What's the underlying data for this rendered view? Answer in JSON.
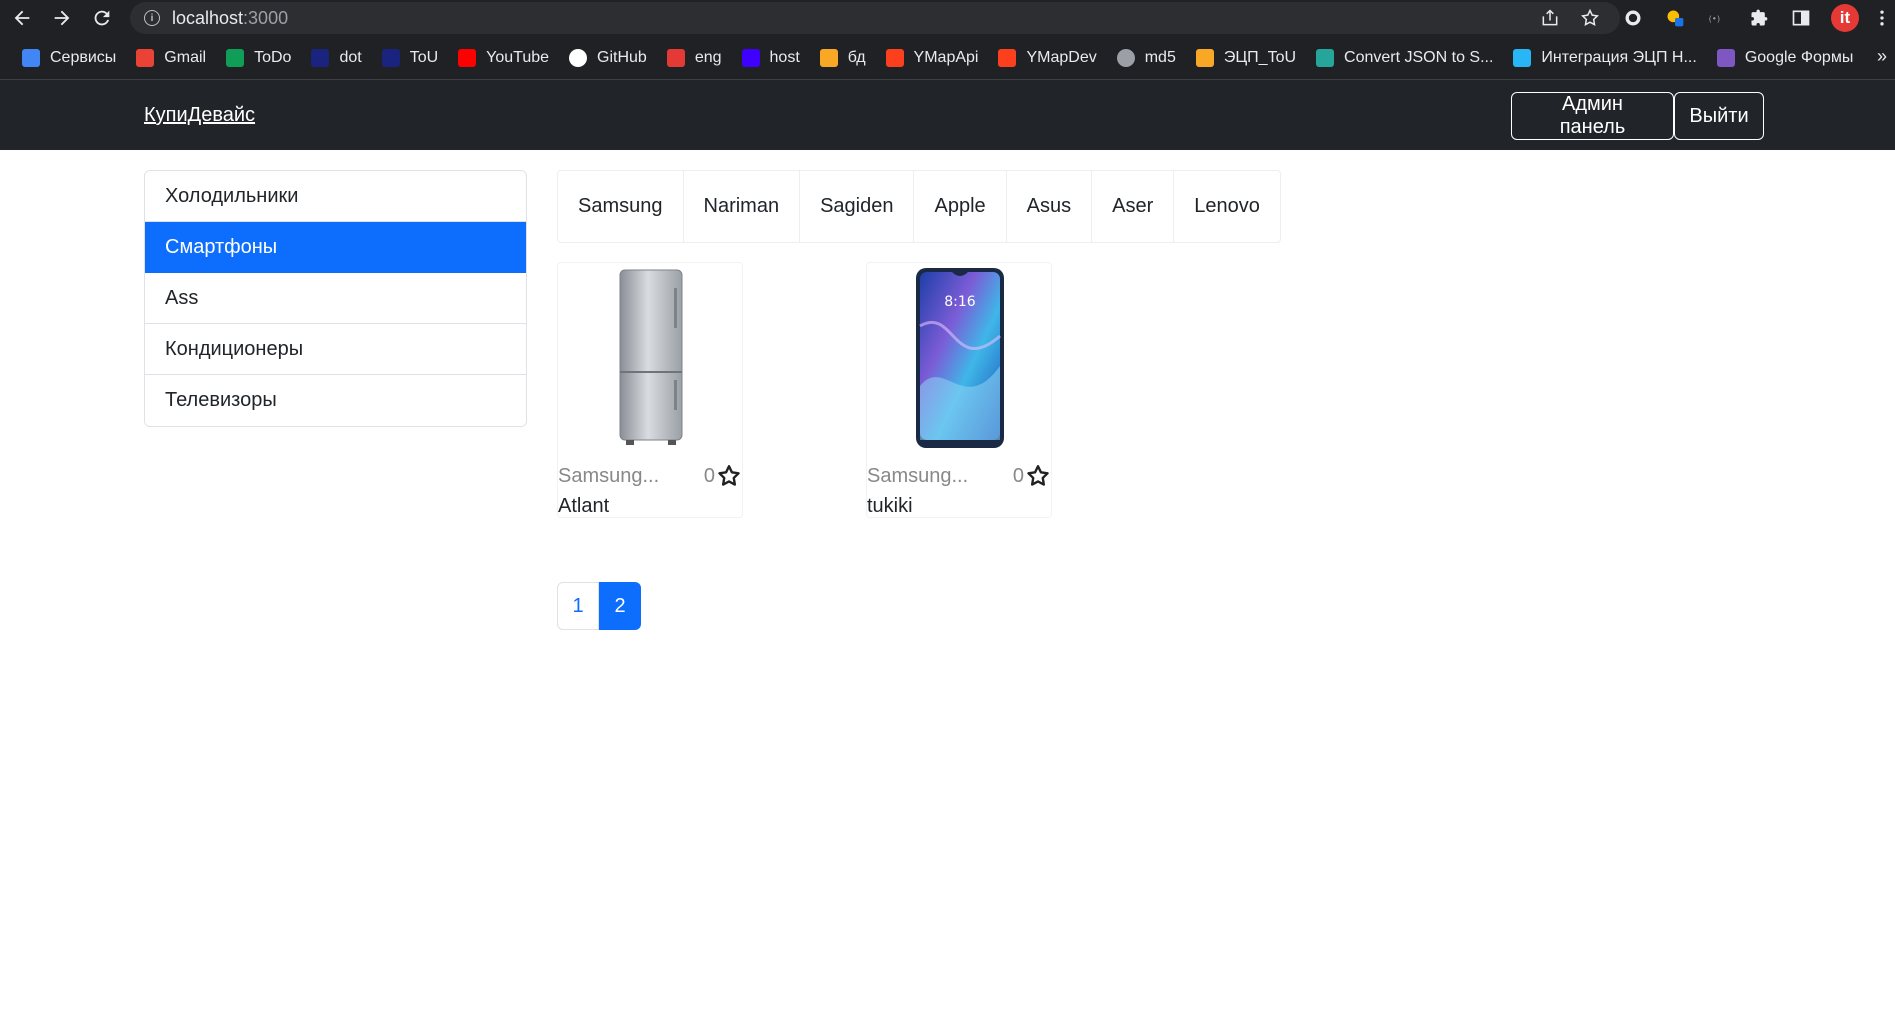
{
  "browser": {
    "url_host": "localhost",
    "url_port": ":3000",
    "bookmarks": [
      {
        "label": "Сервисы",
        "icon": "apps-grid-icon",
        "color": "#4285f4"
      },
      {
        "label": "Gmail",
        "icon": "gmail-icon",
        "color": "#ea4335"
      },
      {
        "label": "ToDo",
        "icon": "todo-icon",
        "color": "#0f9d58"
      },
      {
        "label": "dot",
        "icon": "dot-icon",
        "color": "#1a237e"
      },
      {
        "label": "ToU",
        "icon": "tou-icon",
        "color": "#1a237e"
      },
      {
        "label": "YouTube",
        "icon": "youtube-icon",
        "color": "#ff0000"
      },
      {
        "label": "GitHub",
        "icon": "github-icon",
        "color": "#ffffff"
      },
      {
        "label": "eng",
        "icon": "eng-icon",
        "color": "#e53935"
      },
      {
        "label": "host",
        "icon": "host-icon",
        "color": "#3f00ff"
      },
      {
        "label": "бд",
        "icon": "db-icon",
        "color": "#f9a825"
      },
      {
        "label": "YMapApi",
        "icon": "yandex-icon",
        "color": "#fc3f1d"
      },
      {
        "label": "YMapDev",
        "icon": "yandex-icon",
        "color": "#fc3f1d"
      },
      {
        "label": "md5",
        "icon": "globe-icon",
        "color": "#9aa0a6"
      },
      {
        "label": "ЭЦП_ToU",
        "icon": "rocket-icon",
        "color": "#f9a825"
      },
      {
        "label": "Convert JSON to S...",
        "icon": "convert-icon",
        "color": "#26a69a"
      },
      {
        "label": "Интеграция ЭЦП Н...",
        "icon": "integration-icon",
        "color": "#29b6f6"
      },
      {
        "label": "Google Формы",
        "icon": "forms-icon",
        "color": "#7e57c2"
      }
    ]
  },
  "navbar": {
    "brand": "КупиДевайс",
    "admin_label": "Админ панель",
    "logout_label": "Выйти"
  },
  "sidebar": {
    "items": [
      {
        "label": "Холодильники",
        "active": false
      },
      {
        "label": "Смартфоны",
        "active": true
      },
      {
        "label": "Ass",
        "active": false
      },
      {
        "label": "Кондиционеры",
        "active": false
      },
      {
        "label": "Телевизоры",
        "active": false
      }
    ]
  },
  "brands": [
    "Samsung",
    "Nariman",
    "Sagiden",
    "Apple",
    "Asus",
    "Aser",
    "Lenovo"
  ],
  "products": [
    {
      "brand": "Samsung...",
      "rating": "0",
      "name": "Atlant",
      "image": "refrigerator"
    },
    {
      "brand": "Samsung...",
      "rating": "0",
      "name": "tukiki",
      "image": "smartphone"
    }
  ],
  "pagination": {
    "pages": [
      "1",
      "2"
    ],
    "active": "2"
  }
}
